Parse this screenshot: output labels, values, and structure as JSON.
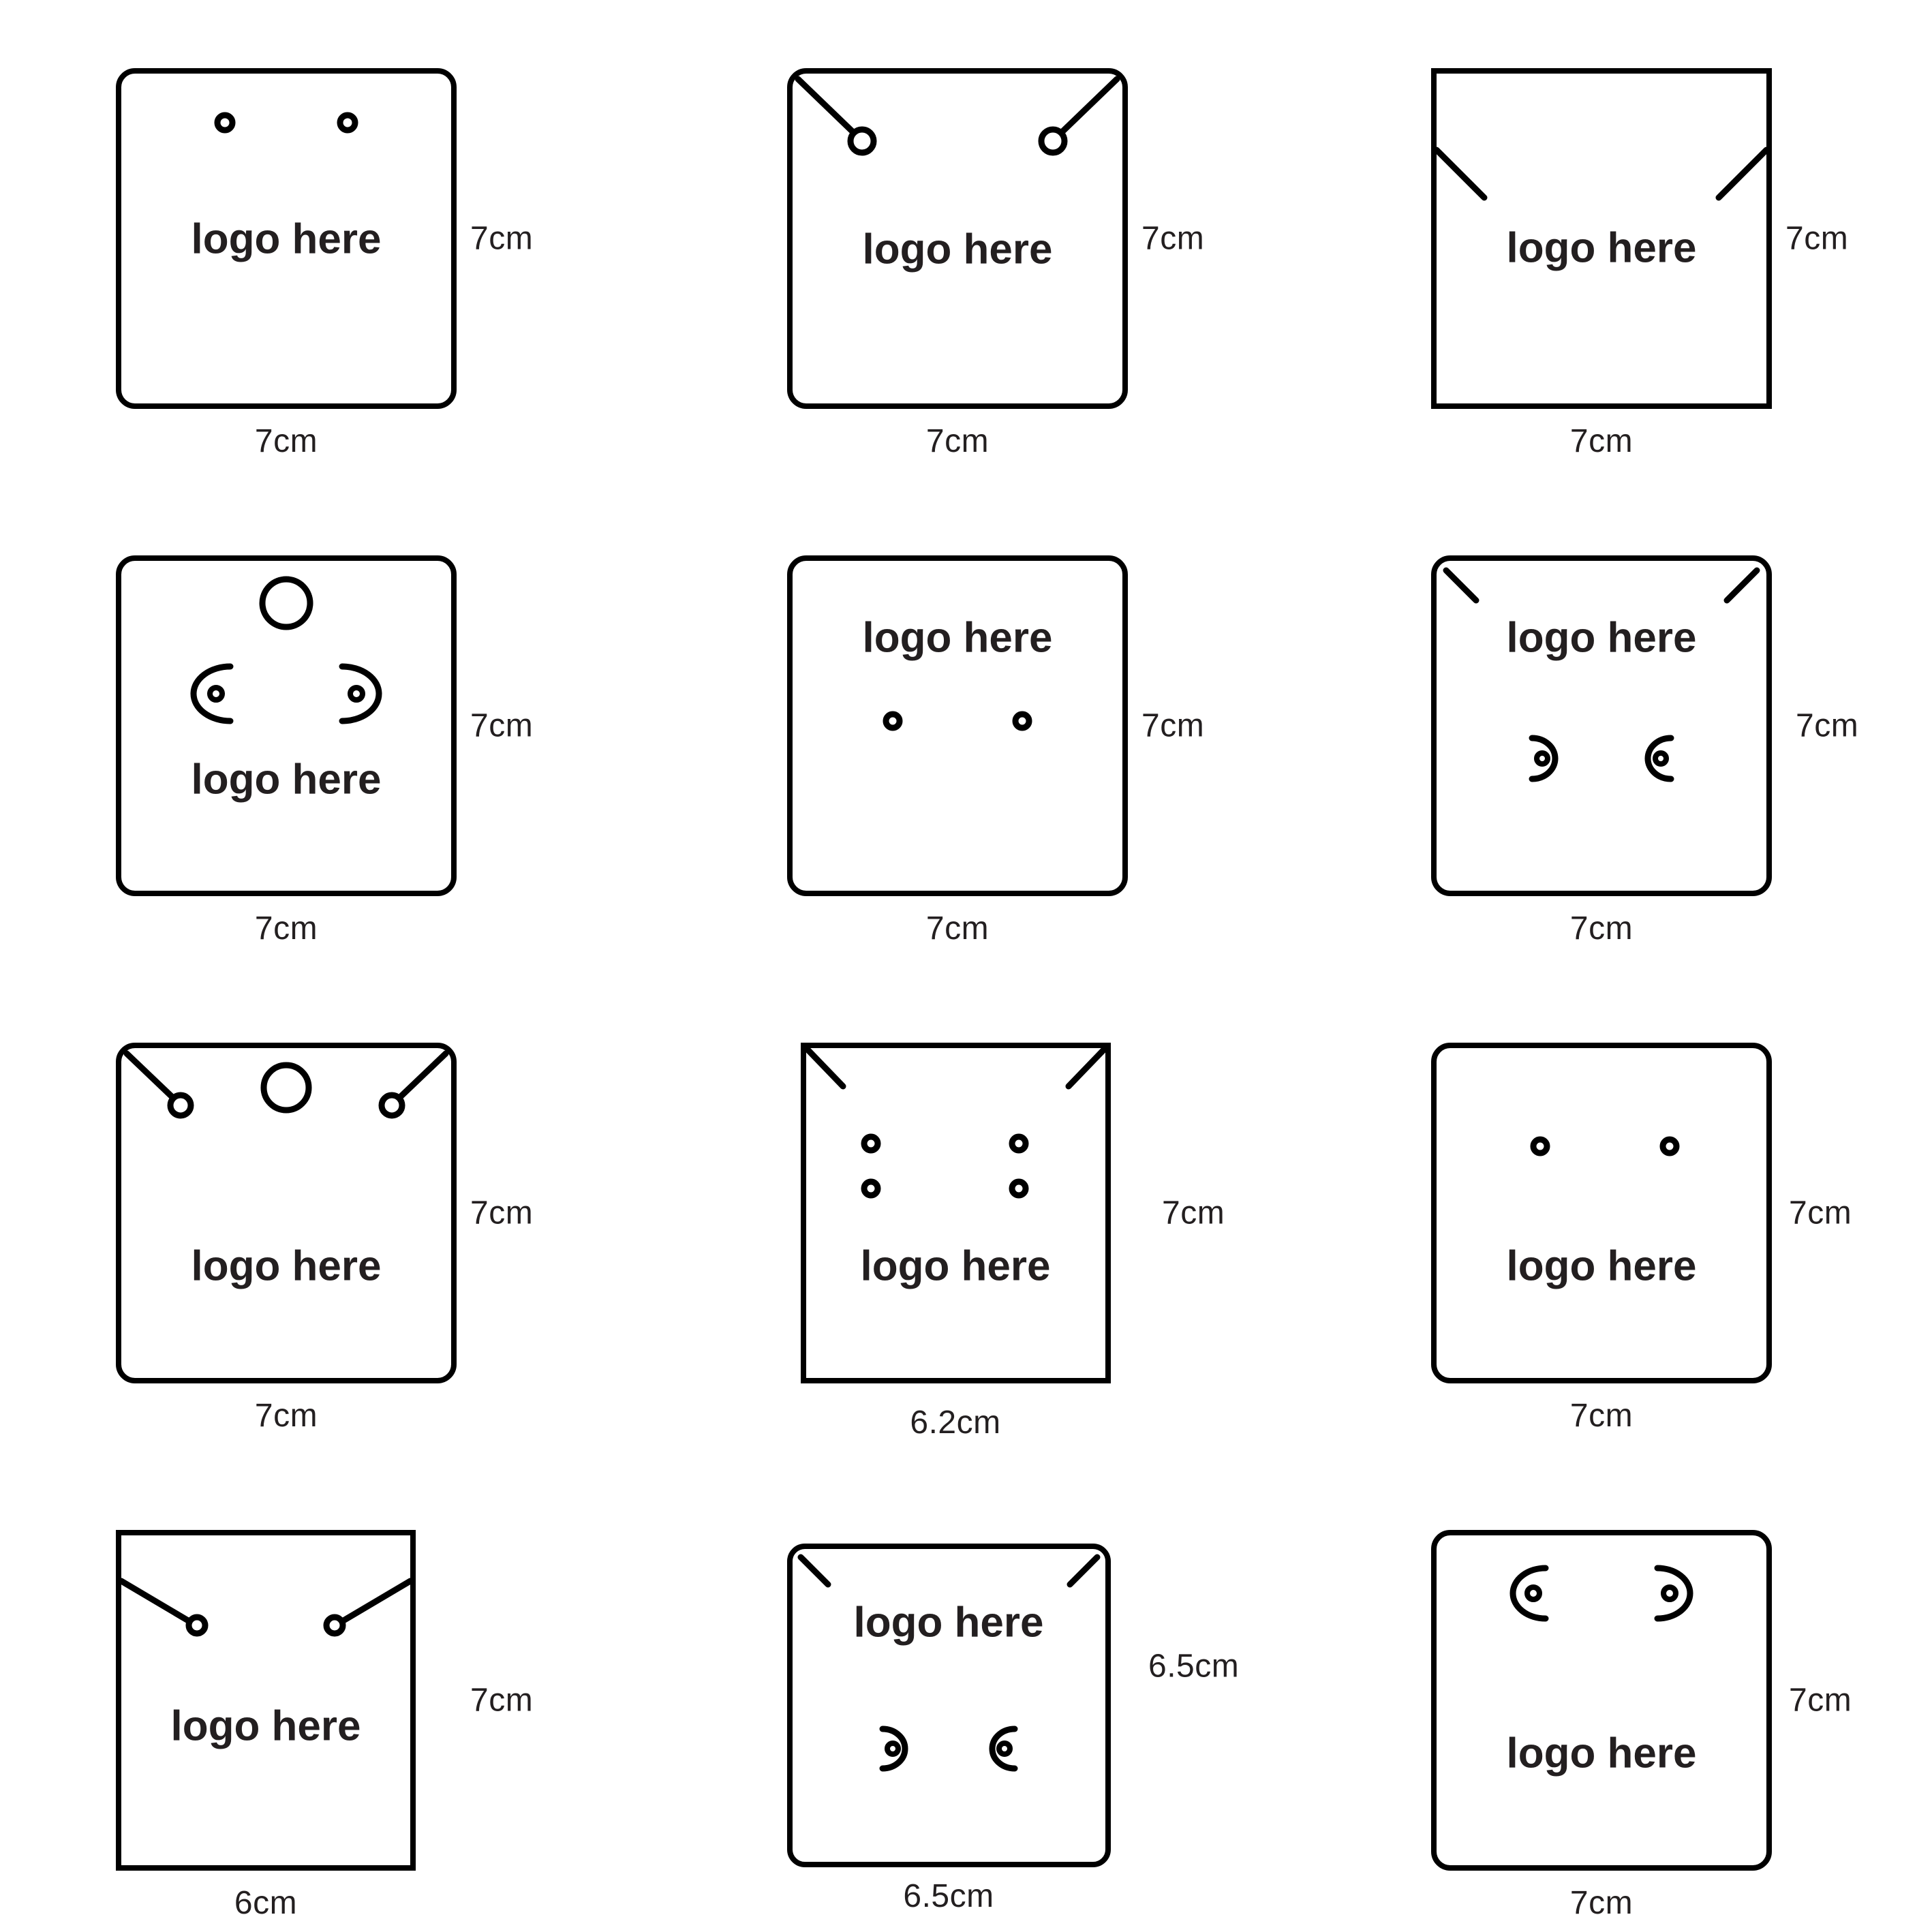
{
  "sheet": {
    "background": "#ffffff",
    "stroke_color": "#000000",
    "text_color": "#231f20",
    "logo_label": "logo here",
    "columns": 3,
    "rows": 4,
    "total_cards": 12
  },
  "cards": [
    {
      "id": "card-1",
      "row": 1,
      "col": 1,
      "width_label": "7cm",
      "height_label": "7cm",
      "corner_style": "rounded",
      "logo_label": "logo here",
      "logo_position": "middle",
      "features": "two-small-holes-top"
    },
    {
      "id": "card-2",
      "row": 1,
      "col": 2,
      "width_label": "7cm",
      "height_label": "7cm",
      "corner_style": "rounded",
      "logo_label": "logo here",
      "logo_position": "middle",
      "features": "corner-diagonal-slits-with-end-holes"
    },
    {
      "id": "card-3",
      "row": 1,
      "col": 3,
      "width_label": "7cm",
      "height_label": "7cm",
      "corner_style": "square",
      "logo_label": "logo here",
      "logo_position": "middle",
      "features": "plain-diagonal-slits-lower"
    },
    {
      "id": "card-4",
      "row": 2,
      "col": 1,
      "width_label": "7cm",
      "height_label": "7cm",
      "corner_style": "rounded",
      "logo_label": "logo here",
      "logo_position": "lower-middle",
      "features": "large-hang-circle-plus-two-oval-slits"
    },
    {
      "id": "card-5",
      "row": 2,
      "col": 2,
      "width_label": "7cm",
      "height_label": "7cm",
      "corner_style": "rounded",
      "logo_label": "logo here",
      "logo_position": "upper-middle",
      "features": "two-small-holes-below-logo"
    },
    {
      "id": "card-6",
      "row": 2,
      "col": 3,
      "width_label": "7cm",
      "height_label": "7cm",
      "corner_style": "rounded",
      "logo_label": "logo here",
      "logo_position": "upper-middle",
      "features": "corner-notches-plus-two-c-slits"
    },
    {
      "id": "card-7",
      "row": 3,
      "col": 1,
      "width_label": "7cm",
      "height_label": "7cm",
      "corner_style": "rounded",
      "logo_label": "logo here",
      "logo_position": "lower-middle",
      "features": "large-hang-circle-plus-corner-keyhole-slits"
    },
    {
      "id": "card-8",
      "row": 3,
      "col": 2,
      "width_label": "6.2cm",
      "height_label": "7cm",
      "corner_style": "square",
      "logo_label": "logo here",
      "logo_position": "lower-middle",
      "features": "corner-notches-plus-four-holes"
    },
    {
      "id": "card-9",
      "row": 3,
      "col": 3,
      "width_label": "7cm",
      "height_label": "7cm",
      "corner_style": "rounded",
      "logo_label": "logo here",
      "logo_position": "lower-middle",
      "features": "two-small-holes-upper"
    },
    {
      "id": "card-10",
      "row": 4,
      "col": 1,
      "width_label": "6cm",
      "height_label": "7cm",
      "corner_style": "square",
      "logo_label": "logo here",
      "logo_position": "lower-middle",
      "features": "side-diagonal-slits-with-end-holes"
    },
    {
      "id": "card-11",
      "row": 4,
      "col": 2,
      "width_label": "6.5cm",
      "height_label": "6.5cm",
      "corner_style": "rounded",
      "logo_label": "logo here",
      "logo_position": "upper-middle",
      "features": "corner-notches-plus-two-c-slits"
    },
    {
      "id": "card-12",
      "row": 4,
      "col": 3,
      "width_label": "7cm",
      "height_label": "7cm",
      "corner_style": "rounded",
      "logo_label": "logo here",
      "logo_position": "lower-middle",
      "features": "two-oval-slits-top"
    }
  ]
}
